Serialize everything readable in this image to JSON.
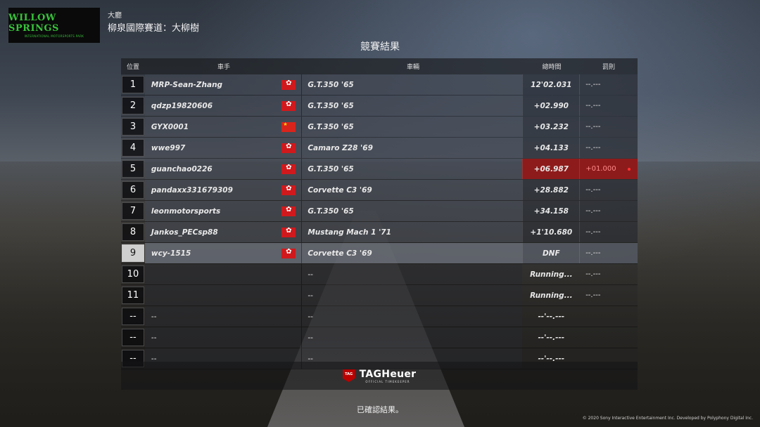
{
  "header": {
    "logo_text": "WILLOW SPRINGS",
    "logo_sub": "INTERNATIONAL MOTORSPORTS PARK",
    "event_category": "大廳",
    "track_name": "柳泉國際賽道：大柳樹"
  },
  "results_title": "競賽結果",
  "columns": {
    "position": "位置",
    "driver": "車手",
    "car": "車輛",
    "total_time": "總時間",
    "penalty": "罰則"
  },
  "rows": [
    {
      "pos": "1",
      "driver": "MRP-Sean-Zhang",
      "flag": "hk",
      "car": "G.T.350 '65",
      "time": "12'02.031",
      "penalty": "--.---"
    },
    {
      "pos": "2",
      "driver": "qdzp19820606",
      "flag": "hk",
      "car": "G.T.350 '65",
      "time": "+02.990",
      "penalty": "--.---"
    },
    {
      "pos": "3",
      "driver": "GYX0001",
      "flag": "cn",
      "car": "G.T.350 '65",
      "time": "+03.232",
      "penalty": "--.---"
    },
    {
      "pos": "4",
      "driver": "wwe997",
      "flag": "hk",
      "car": "Camaro Z28 '69",
      "time": "+04.133",
      "penalty": "--.---"
    },
    {
      "pos": "5",
      "driver": "guanchao0226",
      "flag": "hk",
      "car": "G.T.350 '65",
      "time": "+06.987",
      "penalty": "+01.000"
    },
    {
      "pos": "6",
      "driver": "pandaxx331679309",
      "flag": "hk",
      "car": "Corvette C3 '69",
      "time": "+28.882",
      "penalty": "--.---"
    },
    {
      "pos": "7",
      "driver": "leonmotorsports",
      "flag": "hk",
      "car": "G.T.350 '65",
      "time": "+34.158",
      "penalty": "--.---"
    },
    {
      "pos": "8",
      "driver": "Jankos_PECsp88",
      "flag": "hk",
      "car": "Mustang Mach 1 '71",
      "time": "+1'10.680",
      "penalty": "--.---"
    },
    {
      "pos": "9",
      "driver": "wcy-1515",
      "flag": "hk",
      "car": "Corvette C3 '69",
      "time": "DNF",
      "penalty": "--.---"
    },
    {
      "pos": "10",
      "driver": "",
      "flag": "",
      "car": "--",
      "time": "Running...",
      "penalty": "--.---"
    },
    {
      "pos": "11",
      "driver": "",
      "flag": "",
      "car": "--",
      "time": "Running...",
      "penalty": "--.---"
    },
    {
      "pos": "--",
      "driver": "--",
      "flag": "",
      "car": "--",
      "time": "--'--.---",
      "penalty": ""
    },
    {
      "pos": "--",
      "driver": "--",
      "flag": "",
      "car": "--",
      "time": "--'--.---",
      "penalty": ""
    },
    {
      "pos": "--",
      "driver": "--",
      "flag": "",
      "car": "--",
      "time": "--'--.---",
      "penalty": ""
    }
  ],
  "sponsor": {
    "main": "TAGHeuer",
    "sub": "OFFICIAL TIMEKEEPER",
    "shield": "TAG"
  },
  "confirm_text": "已確認結果。",
  "copyright": "© 2020 Sony Interactive Entertainment Inc. Developed by Polyphony Digital Inc."
}
